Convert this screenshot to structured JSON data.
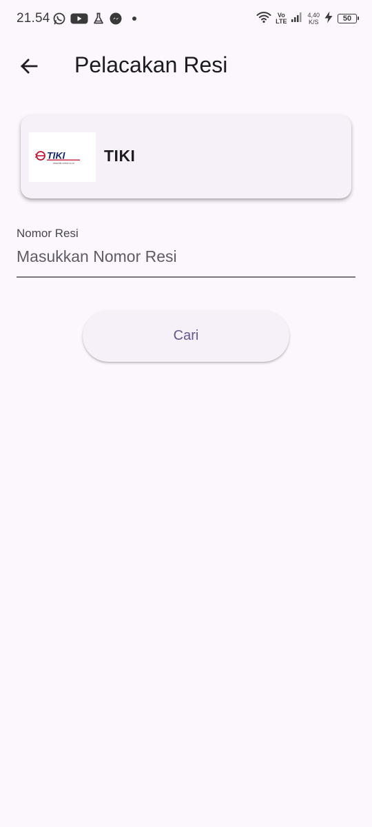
{
  "status_bar": {
    "time": "21.54",
    "icons_left": [
      "whatsapp-icon",
      "youtube-icon",
      "flask-icon",
      "messenger-icon",
      "dot-icon"
    ],
    "network": {
      "volte_top": "Vo",
      "volte_bottom": "LTE"
    },
    "speed": {
      "value": "4,40",
      "unit": "K/S"
    },
    "battery": "50"
  },
  "app_bar": {
    "back_icon": "arrow-back-icon",
    "title": "Pelacakan Resi"
  },
  "courier": {
    "name": "TIKI",
    "logo_text": "TIKI",
    "logo_subtext": "www.tiki-online.co.id",
    "logo_icon": "tiki-logo-icon"
  },
  "tracking_field": {
    "label": "Nomor Resi",
    "placeholder": "Masukkan Nomor Resi",
    "value": ""
  },
  "search_button": {
    "label": "Cari"
  },
  "colors": {
    "background": "#fcf6fd",
    "card": "#f6f1f8",
    "primary": "#65558f",
    "logo_red": "#c8102e",
    "logo_navy": "#1a2a6c"
  }
}
